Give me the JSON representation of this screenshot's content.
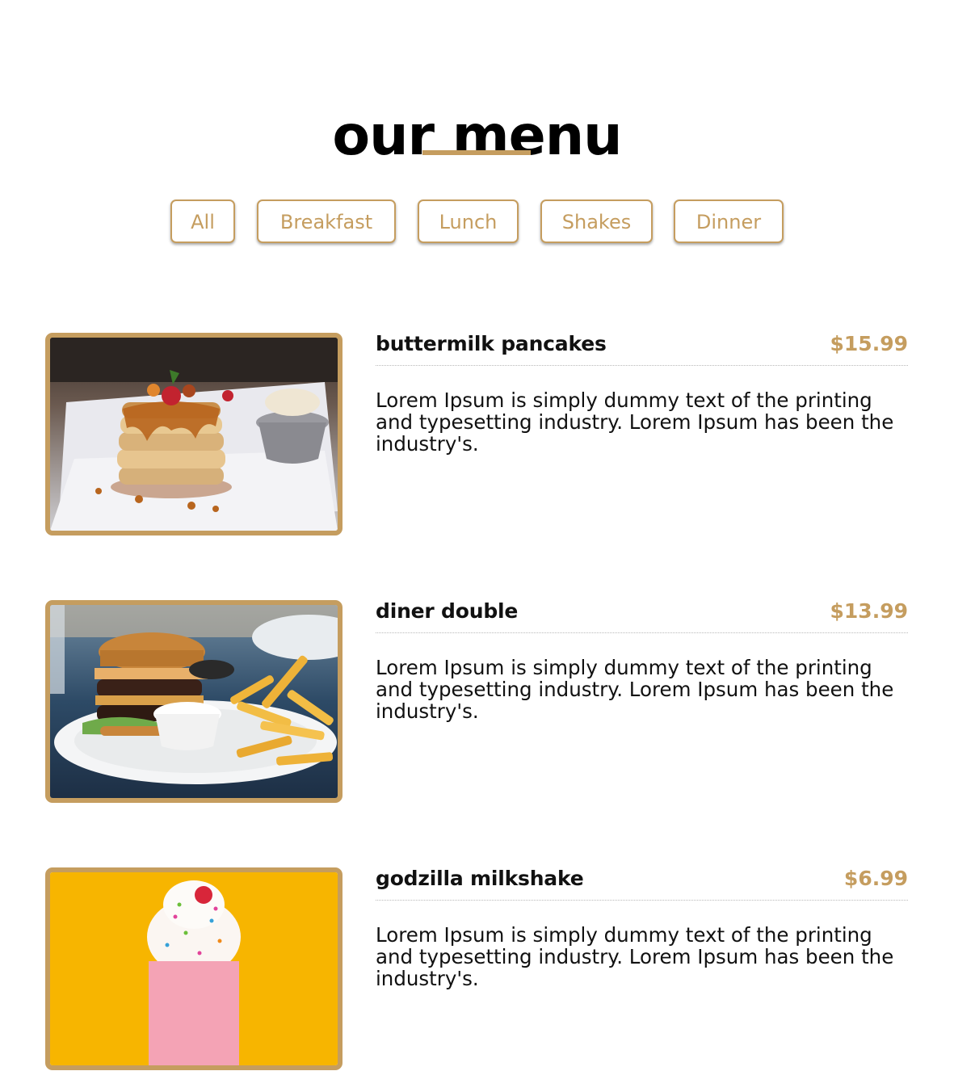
{
  "page": {
    "title": "our menu"
  },
  "filters": [
    {
      "label": "All"
    },
    {
      "label": "Breakfast"
    },
    {
      "label": "Lunch"
    },
    {
      "label": "Shakes"
    },
    {
      "label": "Dinner"
    }
  ],
  "menu": [
    {
      "name": "buttermilk pancakes",
      "price": "$15.99",
      "desc": "Lorem Ipsum is simply dummy text of the printing and typesetting industry. Lorem Ipsum has been the industry's.",
      "image": "pancakes-photo"
    },
    {
      "name": "diner double",
      "price": "$13.99",
      "desc": "Lorem Ipsum is simply dummy text of the printing and typesetting industry. Lorem Ipsum has been the industry's.",
      "image": "burger-photo"
    },
    {
      "name": "godzilla milkshake",
      "price": "$6.99",
      "desc": "Lorem Ipsum is simply dummy text of the printing and typesetting industry. Lorem Ipsum has been the industry's.",
      "image": "milkshake-photo"
    }
  ],
  "colors": {
    "accent": "#c59d5f",
    "text": "#111111",
    "background": "#ffffff"
  }
}
